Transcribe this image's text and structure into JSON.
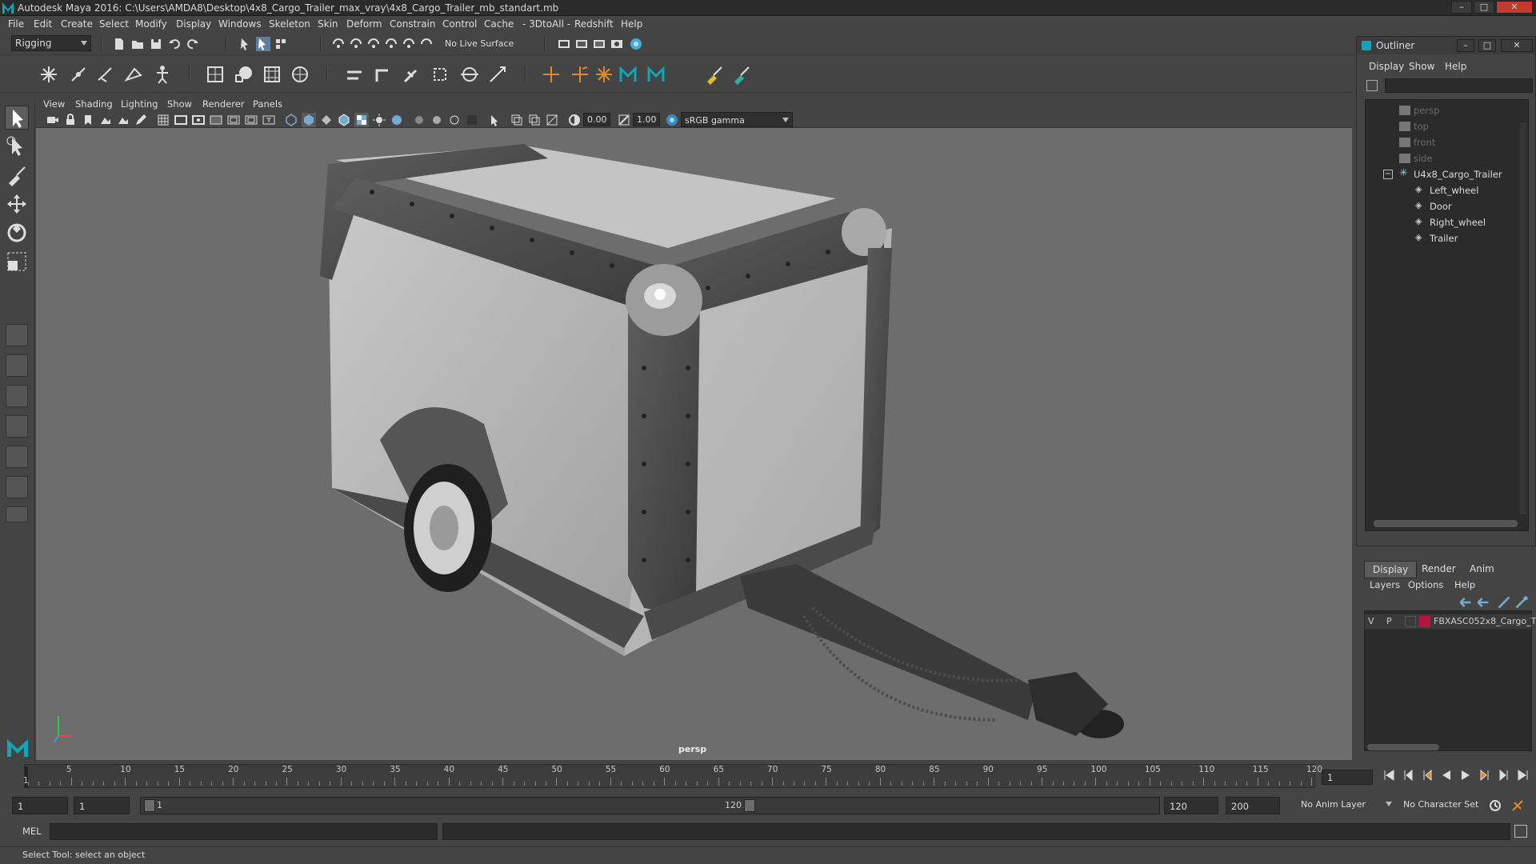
{
  "window": {
    "title": "Autodesk Maya 2016: C:\\Users\\AMDA8\\Desktop\\4x8_Cargo_Trailer_max_vray\\4x8_Cargo_Trailer_mb_standart.mb",
    "controls": [
      "minimize-icon",
      "maximize-icon",
      "close-icon"
    ]
  },
  "menubar": {
    "items": [
      "File",
      "Edit",
      "Create",
      "Select",
      "Modify",
      "Display",
      "Windows",
      "Skeleton",
      "Skin",
      "Deform",
      "Constrain",
      "Control",
      "Cache",
      "- 3DtoAll -",
      "Redshift",
      "Help"
    ]
  },
  "statusline": {
    "mode": "Rigging",
    "live_surface": "No Live Surface"
  },
  "viewport": {
    "menu": [
      "View",
      "Shading",
      "Lighting",
      "Show",
      "Renderer",
      "Panels"
    ],
    "near_value": "0.00",
    "far_value": "1.00",
    "color_space": "sRGB gamma",
    "camera_label": "persp"
  },
  "outliner": {
    "title": "Outliner",
    "menu": [
      "Display",
      "Show",
      "Help"
    ],
    "items": [
      {
        "label": "persp",
        "icon": "camera-icon",
        "dim": true
      },
      {
        "label": "top",
        "icon": "camera-icon",
        "dim": true
      },
      {
        "label": "front",
        "icon": "camera-icon",
        "dim": true
      },
      {
        "label": "side",
        "icon": "camera-icon",
        "dim": true
      },
      {
        "label": "U4x8_Cargo_Trailer",
        "icon": "group-icon",
        "dim": false
      },
      {
        "label": "Left_wheel",
        "icon": "mesh-icon",
        "dim": false
      },
      {
        "label": "Door",
        "icon": "mesh-icon",
        "dim": false
      },
      {
        "label": "Right_wheel",
        "icon": "mesh-icon",
        "dim": false
      },
      {
        "label": "Trailer",
        "icon": "mesh-icon",
        "dim": false
      }
    ]
  },
  "layer_editor": {
    "tabs": [
      "Display",
      "Render",
      "Anim"
    ],
    "active_tab": "Display",
    "menu": [
      "Layers",
      "Options",
      "Help"
    ],
    "layer": {
      "visible": "V",
      "playback": "P",
      "name": "FBXASC052x8_Cargo_T",
      "color": "#b0173a"
    }
  },
  "timeline": {
    "ticks": [
      "5",
      "10",
      "15",
      "20",
      "25",
      "30",
      "35",
      "40",
      "45",
      "50",
      "55",
      "60",
      "65",
      "70",
      "75",
      "80",
      "85",
      "90",
      "95",
      "100",
      "105",
      "110",
      "115",
      "120"
    ],
    "start_tick": "1",
    "current_frame": "1"
  },
  "range": {
    "start": "1",
    "playback_start": "1",
    "slider_start": "1",
    "slider_end": "120",
    "playback_end": "120",
    "end": "200",
    "anim_layer": "No Anim Layer",
    "character_set": "No Character Set"
  },
  "commandline": {
    "language": "MEL"
  },
  "helpline": {
    "text": "Select Tool: select an object"
  },
  "colors": {
    "ui_bg": "#444444",
    "viewport_bg": "#6d6d6d",
    "field_bg": "#2b2b2b",
    "accent": "#12a5b5"
  }
}
